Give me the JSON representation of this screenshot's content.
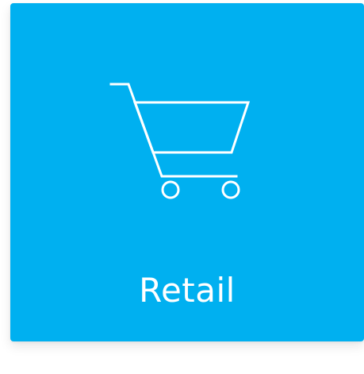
{
  "tile": {
    "label": "Retail",
    "icon": "shopping-cart-icon",
    "background": "#00b0f0",
    "foreground": "#ffffff"
  }
}
